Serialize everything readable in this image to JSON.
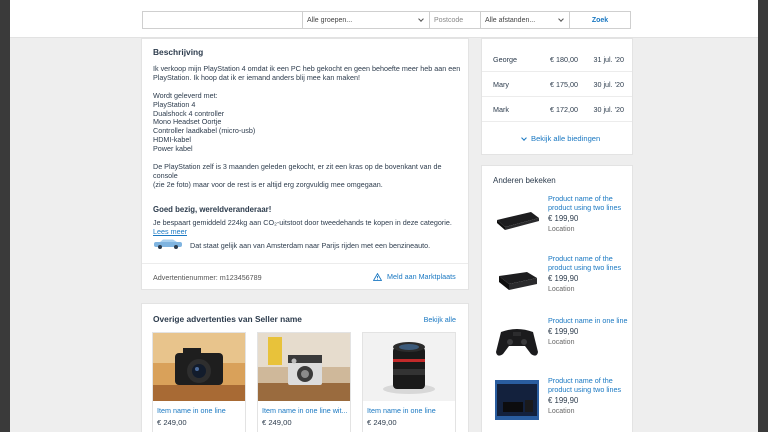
{
  "search": {
    "query_placeholder": "",
    "group_value": "Alle groepen...",
    "zip_placeholder": "Postcode",
    "distance_value": "Alle afstanden...",
    "button_label": "Zoek"
  },
  "description": {
    "heading": "Beschrijving",
    "text": "Ik verkoop mijn PlayStation 4 omdat ik een PC heb gekocht en geen behoefte meer heb aan een\nPlayStation. Ik hoop dat ik er iemand anders blij mee kan maken!\n\nWordt geleverd met:\nPlayStation 4\nDualshock 4 controller\nMono Headset Oortje\nController laadkabel (micro-usb)\nHDMI-kabel\nPower kabel\n\nDe PlayStation zelf is 3 maanden geleden gekocht, er zit een kras op de bovenkant van de console\n(zie 2e foto) maar voor de rest is er altijd erg zorgvuldig mee omgegaan.",
    "eco_title": "Goed bezig, wereldveranderaar!",
    "eco_line1": "Je bespaart gemiddeld 224kg aan CO₂-uitstoot door tweedehands te kopen in deze categorie.",
    "eco_link": "Lees meer",
    "eco_line2": "Dat staat gelijk aan van Amsterdam naar Parijs rijden met een benzineauto.",
    "ad_number": "Advertentienummer: m123456789",
    "report_label": "Meld aan Marktplaats"
  },
  "other_listings": {
    "heading": "Overige advertenties van Seller name",
    "view_all": "Bekijk alle",
    "items": [
      {
        "title": "Item name in one line",
        "price": "€ 249,00"
      },
      {
        "title": "Item name in one line wit...",
        "price": "€ 249,00"
      },
      {
        "title": "Item name in one line",
        "price": "€ 249,00"
      }
    ]
  },
  "bids": {
    "rows": [
      {
        "name": "George",
        "amount": "€ 180,00",
        "date": "31 jul. '20"
      },
      {
        "name": "Mary",
        "amount": "€ 175,00",
        "date": "30 jul. '20"
      },
      {
        "name": "Mark",
        "amount": "€ 172,00",
        "date": "30 jul. '20"
      }
    ],
    "view_all": "Bekijk alle biedingen"
  },
  "others_viewed": {
    "heading": "Anderen bekeken",
    "items": [
      {
        "title": "Product name of the product using two lines",
        "price": "€ 199,90",
        "location": "Location"
      },
      {
        "title": "Product name of the product using two lines",
        "price": "€ 199,90",
        "location": "Location"
      },
      {
        "title": "Product name in one line",
        "price": "€ 199,90",
        "location": "Location"
      },
      {
        "title": "Product name of the product using two lines",
        "price": "€ 199,90",
        "location": "Location"
      }
    ]
  },
  "colors": {
    "link": "#1a78c2",
    "text": "#2d3c4d",
    "background": "#eeeeee"
  }
}
